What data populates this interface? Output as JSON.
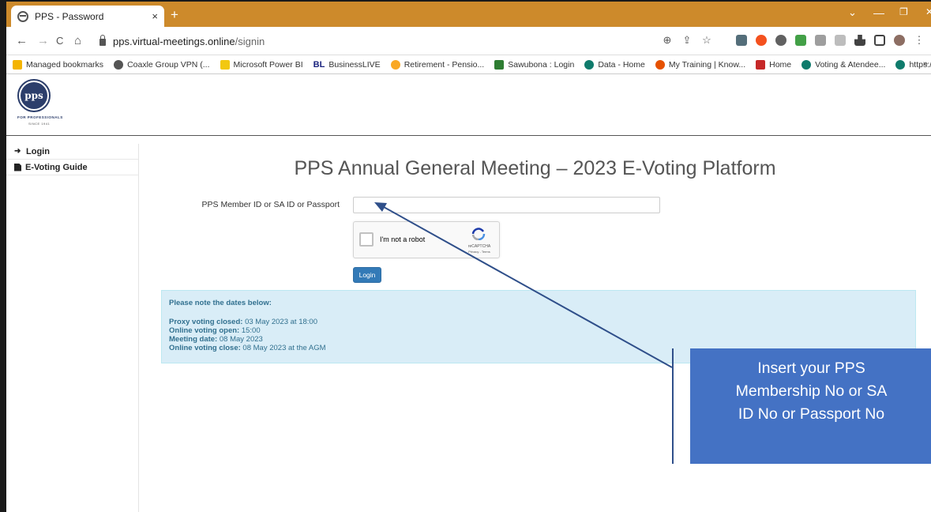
{
  "browser": {
    "tab_title": "PPS - Password",
    "tab_close": "×",
    "new_tab": "+",
    "url_host": "pps.virtual-meetings.online",
    "url_path": "/signin",
    "win_min": "—",
    "win_restore": "❐",
    "win_close": "✕",
    "win_chevron": "⌄",
    "nav_back": "←",
    "nav_forward": "→",
    "nav_reload": "C",
    "nav_home": "⌂",
    "omni_zoom": "⊕",
    "omni_share": "⇪",
    "omni_star": "☆",
    "menu_dots": "⋮"
  },
  "bookmarks": [
    {
      "label": "Managed bookmarks",
      "color": "#f4b400"
    },
    {
      "label": "Coaxle Group VPN (...",
      "color": "#555555"
    },
    {
      "label": "Microsoft Power BI",
      "color": "#f2c811"
    },
    {
      "label": "BusinessLIVE",
      "color": "#1a237e"
    },
    {
      "label": "Retirement - Pensio...",
      "color": "#f9a825"
    },
    {
      "label": "Sawubona : Login",
      "color": "#2e7d32"
    },
    {
      "label": "Data - Home",
      "color": "#0f7b6c"
    },
    {
      "label": "My Training | Know...",
      "color": "#e65100"
    },
    {
      "label": "Home",
      "color": "#c62828"
    },
    {
      "label": "Voting & Atendee...",
      "color": "#0f7b6c"
    },
    {
      "label": "https://inceedit.sha...",
      "color": "#0f7b6c"
    }
  ],
  "bookmarks_more": "»",
  "logo": {
    "text": "pps",
    "tagline": "FOR PROFESSIONALS",
    "since": "SINCE 1941"
  },
  "sidebar": {
    "items": [
      {
        "label": "Login",
        "icon": "login-icon"
      },
      {
        "label": "E-Voting Guide",
        "icon": "document-icon"
      }
    ]
  },
  "main": {
    "title": "PPS Annual General Meeting – 2023 E-Voting Platform",
    "field_label": "PPS Member ID or SA ID or Passport",
    "field_value": "",
    "captcha_label": "I'm not a robot",
    "captcha_brand": "reCAPTCHA",
    "captcha_terms": "Privacy - Terms",
    "login_button": "Login"
  },
  "notice": {
    "heading": "Please note the dates below:",
    "rows": [
      {
        "label": "Proxy voting closed:",
        "value": " 03 May 2023 at 18:00"
      },
      {
        "label": "Online voting open:",
        "value": " 15:00"
      },
      {
        "label": "Meeting date:",
        "value": " 08 May 2023"
      },
      {
        "label": "Online voting close:",
        "value": " 08 May 2023 at the AGM"
      }
    ]
  },
  "callout": {
    "line1": "Insert your PPS",
    "line2": "Membership No or SA",
    "line3": "ID No or Passport No"
  },
  "colors": {
    "tabstrip": "#cd8a2b",
    "accent": "#337ab7",
    "notice_bg": "#d9edf7",
    "callout_bg": "#4472c4"
  }
}
